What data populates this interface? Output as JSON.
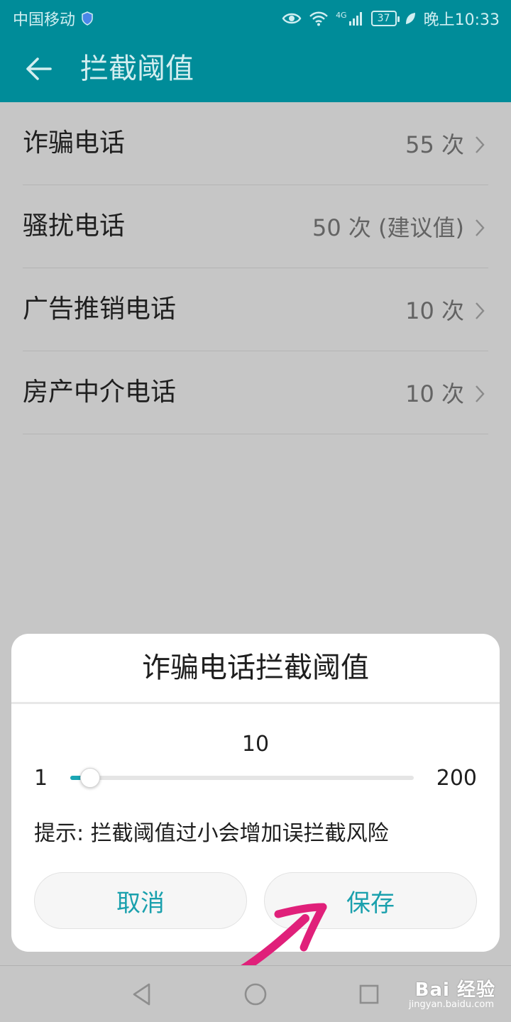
{
  "status_bar": {
    "carrier": "中国移动",
    "network": "4G",
    "battery": "37",
    "time": "晚上10:33"
  },
  "app_bar": {
    "title": "拦截阈值"
  },
  "list": {
    "items": [
      {
        "label": "诈骗电话",
        "value": "55 次"
      },
      {
        "label": "骚扰电话",
        "value": "50 次 (建议值)"
      },
      {
        "label": "广告推销电话",
        "value": "10 次"
      },
      {
        "label": "房产中介电话",
        "value": "10 次"
      }
    ]
  },
  "dialog": {
    "title": "诈骗电话拦截阈值",
    "slider": {
      "value": "10",
      "min": "1",
      "max": "200",
      "value_num": 10,
      "min_num": 1,
      "max_num": 200
    },
    "hint": "提示: 拦截阈值过小会增加误拦截风险",
    "cancel_label": "取消",
    "save_label": "保存"
  },
  "nav_bar": {
    "icons": [
      "back-triangle-icon",
      "home-circle-icon",
      "recents-square-icon"
    ]
  },
  "watermark": {
    "logo": "Bai 经验",
    "url": "jingyan.baidu.com"
  },
  "colors": {
    "accent": "#008c99",
    "button_text": "#1aa0ad",
    "annotation": "#e0207a"
  }
}
